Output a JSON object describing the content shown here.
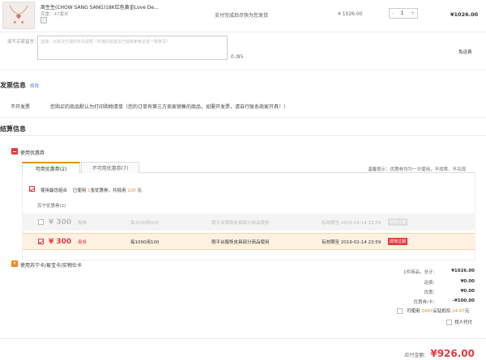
{
  "product": {
    "name": "周生生(CHOW SANG SANG)18K红色黄金Love De...",
    "attr": "克重：47厘米",
    "shipping": "支付完成后尽快为您发货",
    "unit_price": "¥ 1026.00",
    "quantity": "1",
    "minus": "-",
    "plus": "+",
    "subtotal": "¥1026.00"
  },
  "remark": {
    "label": "填写买家留言：",
    "placeholder": "选填：对本次交易的补充说明（所填内容建议已经和卖家达成一致意见）",
    "count": "0 /85",
    "freight": "免运费"
  },
  "invoice": {
    "title": "发票信息",
    "edit": "修改",
    "type": "不开发票",
    "note": "您购买的商品默认为打印购物清单（您的订单有第三方卖家销售的商品，如需开发票，请自行联系商家开具！）"
  },
  "settlement": {
    "title": "结算信息",
    "use_coupon": "使用优惠券",
    "tab_available": "可用优惠券(2)",
    "tab_unavailable": "不可用优惠券(7)",
    "notice": "温馨提示：优惠劵均为一次使用，不找零、不兑现",
    "best": {
      "label": "使用最优组合",
      "pre": "已使用",
      "count": "1",
      "mid": "张优惠券，共抵用",
      "amount": "100",
      "unit": "元"
    },
    "category": "苏宁优惠券(2)",
    "coupons": [
      {
        "value": "¥ 300",
        "type": "易券",
        "condition": "每1000用100",
        "scope": "限平台服饰皮具部分商品使用",
        "expiry": "有效期至 2019-02-14 23:59",
        "tag": "即将过期"
      },
      {
        "value": "¥ 300",
        "type": "易券",
        "condition": "每1000用100",
        "scope": "限平台服饰皮具部分商品使用",
        "expiry": "有效期至 2019-02-14 23:59",
        "tag": "即将过期"
      }
    ],
    "giftcard": "使用苏宁卡/易宝卡/实物仕卡"
  },
  "summary": {
    "items": [
      {
        "label": "1件商品，总计：",
        "value": "¥1026.00"
      },
      {
        "label": "运费：",
        "value": "¥0.00"
      },
      {
        "label": "优惠：",
        "value": "¥0.00"
      },
      {
        "label": "优惠券/卡：",
        "value": "-¥100.00"
      }
    ],
    "yunzuan": {
      "pre": "可使用",
      "count": "2497",
      "mid": "云钻抵扣",
      "amount": "24.97",
      "unit": "元"
    },
    "proxy": "找人代付",
    "total_label": "应付金额：",
    "total_value": "¥926.00"
  }
}
